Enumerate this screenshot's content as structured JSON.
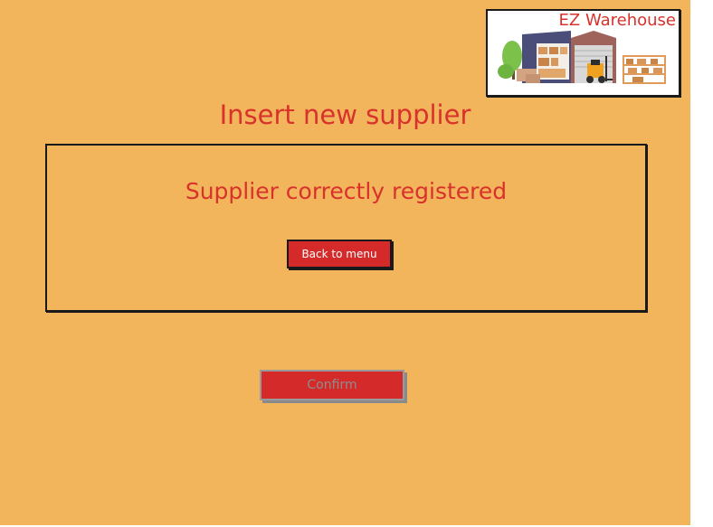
{
  "logo": {
    "text": "EZ Warehouse",
    "icon": "warehouse-illustration"
  },
  "page": {
    "title": "Insert new supplier"
  },
  "message_box": {
    "message": "Supplier correctly registered",
    "back_button_label": "Back to menu"
  },
  "form": {
    "confirm_label": "Confirm",
    "confirm_disabled": true
  },
  "colors": {
    "background": "#f2b55c",
    "accent_red": "#d42a2a",
    "text_red": "#d9312b",
    "disabled_text": "#8e8e8e"
  }
}
